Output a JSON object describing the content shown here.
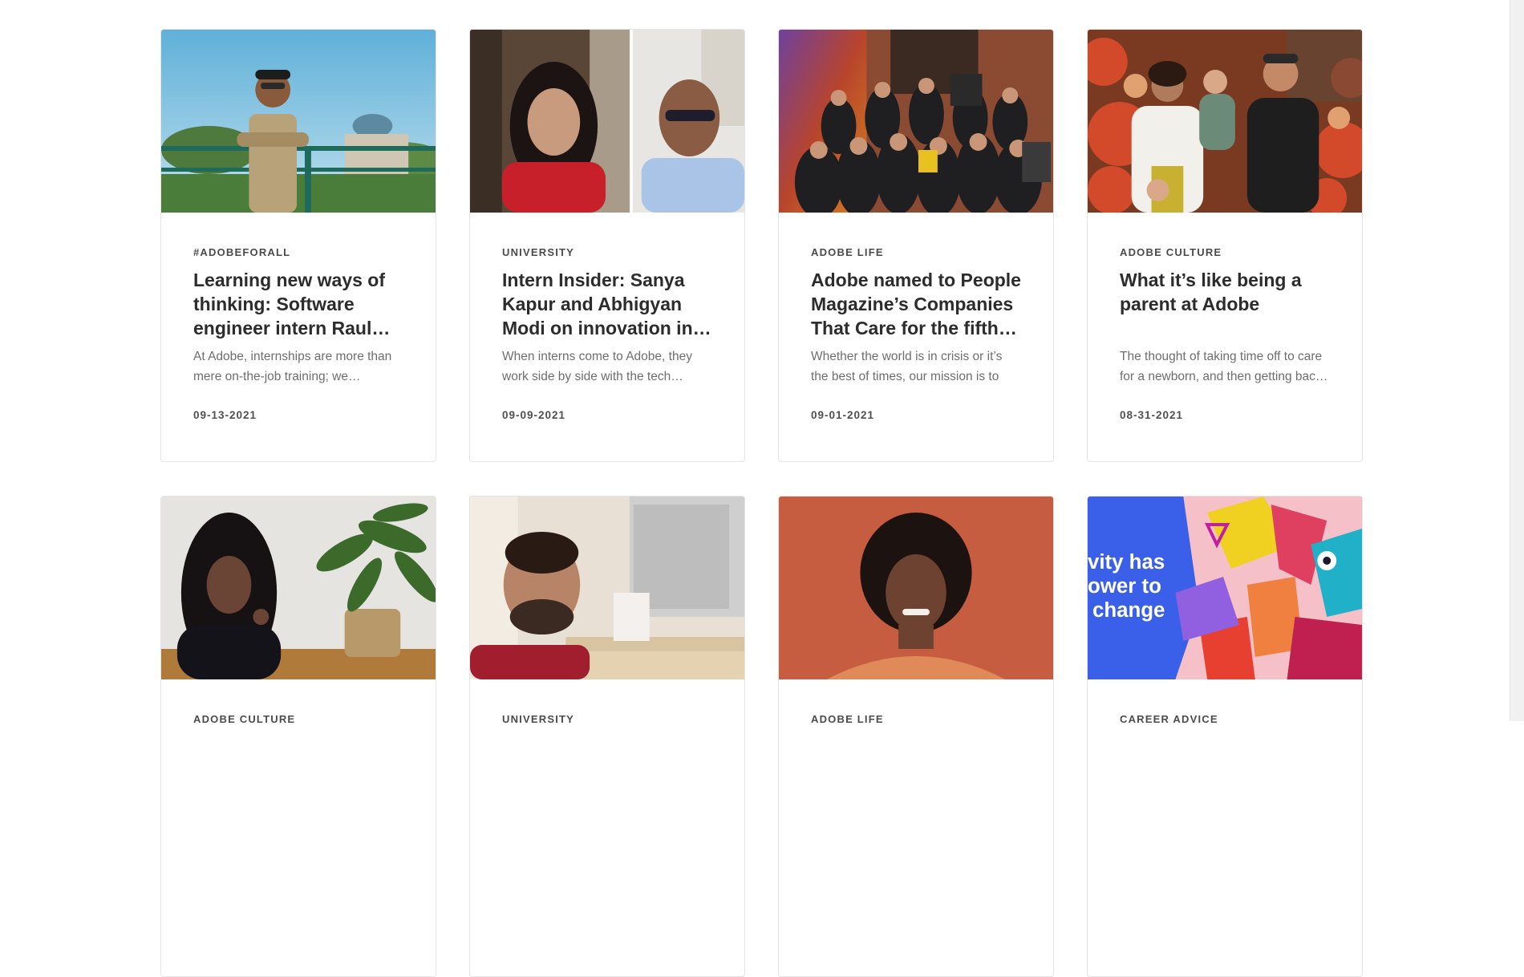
{
  "cards": [
    {
      "category": "#ADOBEFORALL",
      "title": "Learning new ways of thinking: Software engineer intern Raul…",
      "excerpt": "At Adobe, internships are more than mere on-the-job training; we…",
      "date": "09-13-2021",
      "image": "man-leaning-on-railing-photo"
    },
    {
      "category": "UNIVERSITY",
      "title": "Intern Insider: Sanya Kapur and Abhigyan Modi on innovation in…",
      "excerpt": "When interns come to Adobe, they work side by side with the tech…",
      "date": "09-09-2021",
      "image": "video-call-split-photo"
    },
    {
      "category": "ADOBE LIFE",
      "title": "Adobe named to People Magazine’s Companies That Care for the fifth…",
      "excerpt": "Whether the world is in crisis or it’s the best of times, our mission is to chan…",
      "date": "09-01-2021",
      "image": "group-photo"
    },
    {
      "category": "ADOBE CULTURE",
      "title": "What it’s like being a parent at Adobe",
      "excerpt": "The thought of taking time off to care for a newborn, and then getting bac…",
      "date": "08-31-2021",
      "image": "family-photo"
    },
    {
      "category": "ADOBE CULTURE",
      "title": "",
      "excerpt": "",
      "date": "",
      "image": "woman-with-plant-photo"
    },
    {
      "category": "UNIVERSITY",
      "title": "",
      "excerpt": "",
      "date": "",
      "image": "smiling-man-at-desk-photo"
    },
    {
      "category": "ADOBE LIFE",
      "title": "",
      "excerpt": "",
      "date": "",
      "image": "smiling-woman-portrait-photo"
    },
    {
      "category": "CAREER ADVICE",
      "title": "",
      "excerpt": "",
      "date": "",
      "image": "creativity-illustration",
      "image_text": [
        "vity has",
        "ower to",
        "change"
      ]
    }
  ],
  "colors": {
    "card_border": "#e4e4e4",
    "category_text": "#4b4b4b",
    "title_text": "#2c2c2c",
    "excerpt_text": "#6e6e6e"
  }
}
